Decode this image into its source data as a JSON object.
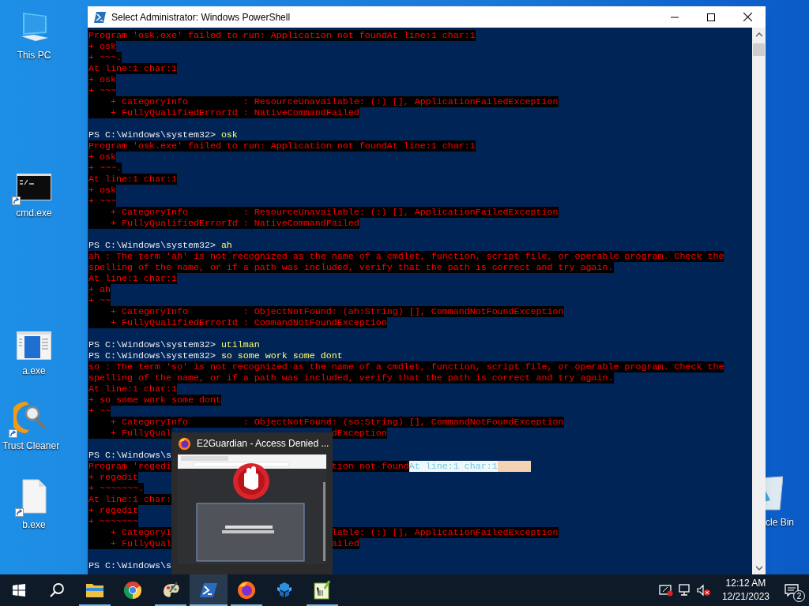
{
  "desktop_icons": [
    {
      "label": "This PC",
      "kind": "computer",
      "shortcut": false
    },
    {
      "label": "cmd.exe",
      "kind": "console",
      "shortcut": true
    },
    {
      "label": "a.exe",
      "kind": "app-window",
      "shortcut": false
    },
    {
      "label": "Trust Cleaner",
      "kind": "cleaner",
      "shortcut": true
    },
    {
      "label": "b.exe",
      "kind": "file",
      "shortcut": true
    },
    {
      "label": "cle Bin",
      "kind": "recycle-bin",
      "shortcut": false
    }
  ],
  "window": {
    "title": "Select Administrator: Windows PowerShell"
  },
  "console_lines": [
    {
      "kind": "error",
      "text": "Program 'osk.exe' failed to run: Application not foundAt line:1 char:1"
    },
    {
      "kind": "error",
      "text": "+ osk"
    },
    {
      "kind": "error",
      "text": "+ ~~~."
    },
    {
      "kind": "error",
      "text": "At line:1 char:1"
    },
    {
      "kind": "error",
      "text": "+ osk"
    },
    {
      "kind": "error",
      "text": "+ ~~~"
    },
    {
      "kind": "error",
      "text": "    + CategoryInfo          : ResourceUnavailable: (:) [], ApplicationFailedException"
    },
    {
      "kind": "error",
      "text": "    + FullyQualifiedErrorId : NativeCommandFailed"
    },
    {
      "kind": "blank"
    },
    {
      "kind": "prompt",
      "text": "PS C:\\Windows\\system32>",
      "command": "osk"
    },
    {
      "kind": "error",
      "text": "Program 'osk.exe' failed to run: Application not foundAt line:1 char:1"
    },
    {
      "kind": "error",
      "text": "+ osk"
    },
    {
      "kind": "error",
      "text": "+ ~~~."
    },
    {
      "kind": "error",
      "text": "At line:1 char:1"
    },
    {
      "kind": "error",
      "text": "+ osk"
    },
    {
      "kind": "error",
      "text": "+ ~~~"
    },
    {
      "kind": "error",
      "text": "    + CategoryInfo          : ResourceUnavailable: (:) [], ApplicationFailedException"
    },
    {
      "kind": "error",
      "text": "    + FullyQualifiedErrorId : NativeCommandFailed"
    },
    {
      "kind": "blank"
    },
    {
      "kind": "prompt",
      "text": "PS C:\\Windows\\system32>",
      "command": "ah"
    },
    {
      "kind": "error",
      "text": "ah : The term 'ah' is not recognized as the name of a cmdlet, function, script file, or operable program. Check the"
    },
    {
      "kind": "error",
      "text": "spelling of the name, or if a path was included, verify that the path is correct and try again."
    },
    {
      "kind": "error",
      "text": "At line:1 char:1"
    },
    {
      "kind": "error",
      "text": "+ ah"
    },
    {
      "kind": "error",
      "text": "+ ~~"
    },
    {
      "kind": "error",
      "text": "    + CategoryInfo          : ObjectNotFound: (ah:String) [], CommandNotFoundException"
    },
    {
      "kind": "error",
      "text": "    + FullyQualifiedErrorId : CommandNotFoundException"
    },
    {
      "kind": "blank"
    },
    {
      "kind": "prompt",
      "text": "PS C:\\Windows\\system32>",
      "command": "utilman"
    },
    {
      "kind": "prompt",
      "text": "PS C:\\Windows\\system32>",
      "command": "so some work some dont"
    },
    {
      "kind": "error",
      "text": "so : The term 'so' is not recognized as the name of a cmdlet, function, script file, or operable program. Check the"
    },
    {
      "kind": "error",
      "text": "spelling of the name, or if a path was included, verify that the path is correct and try again."
    },
    {
      "kind": "error",
      "text": "At line:1 char:1"
    },
    {
      "kind": "error",
      "text": "+ so some work some dont"
    },
    {
      "kind": "error",
      "text": "+ ~~"
    },
    {
      "kind": "error",
      "text": "    + CategoryInfo          : ObjectNotFound: (so:String) [], CommandNotFoundException"
    },
    {
      "kind": "error",
      "text": "    + FullyQual",
      "after": [
        {
          "text": "dException",
          "selected": false
        }
      ]
    },
    {
      "kind": "blank"
    },
    {
      "kind": "prompt",
      "text": "PS C:\\Windows\\s"
    },
    {
      "kind": "error",
      "text": "Program 'regedi",
      "after": [
        {
          "text": "tion not found",
          "selected": false
        },
        {
          "text": "At line:1 char:1",
          "selected": true
        }
      ]
    },
    {
      "kind": "error",
      "text": "+ regedit"
    },
    {
      "kind": "error",
      "text": "+ ~~~~~~~."
    },
    {
      "kind": "error",
      "text": "At line:1 char:"
    },
    {
      "kind": "error",
      "text": "+ regedit"
    },
    {
      "kind": "error",
      "text": "+ ~~~~~~~"
    },
    {
      "kind": "error",
      "text": "    + CategoryI",
      "after": [
        {
          "text": "lable: (:) [], ApplicationFailedException",
          "selected": false
        }
      ]
    },
    {
      "kind": "error",
      "text": "    + FullyQual",
      "after": [
        {
          "text": "ailed",
          "selected": false
        }
      ]
    },
    {
      "kind": "blank"
    },
    {
      "kind": "prompt",
      "text": "PS C:\\Windows\\s"
    }
  ],
  "taskbar_preview": {
    "title": "E2Guardian - Access Denied ..."
  },
  "taskbar": [
    {
      "kind": "start",
      "running": false,
      "selected": false
    },
    {
      "kind": "search",
      "running": false,
      "selected": false
    },
    {
      "kind": "explorer",
      "running": true,
      "selected": false
    },
    {
      "kind": "chrome",
      "running": false,
      "selected": false
    },
    {
      "kind": "paint",
      "running": true,
      "selected": false
    },
    {
      "kind": "powershell",
      "running": true,
      "selected": true
    },
    {
      "kind": "firefox",
      "running": true,
      "selected": false
    },
    {
      "kind": "cube",
      "running": false,
      "selected": false
    },
    {
      "kind": "notepad",
      "running": true,
      "selected": false
    }
  ],
  "tray": {
    "time": "12:12 AM",
    "date": "12/21/2023",
    "notifications": "2"
  }
}
